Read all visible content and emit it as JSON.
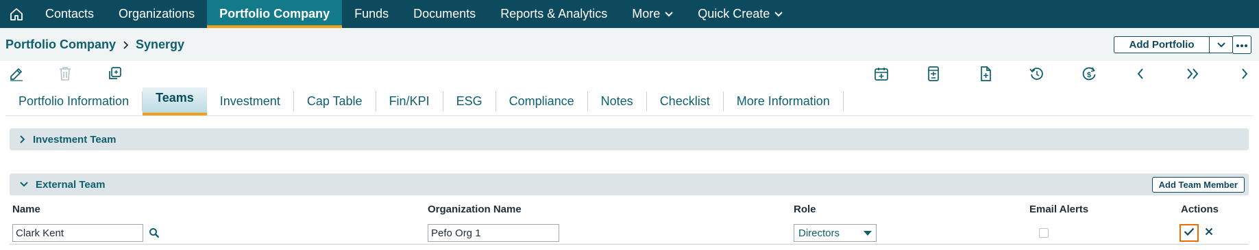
{
  "topnav": {
    "home_icon": "home-icon",
    "items": [
      {
        "label": "Contacts"
      },
      {
        "label": "Organizations"
      },
      {
        "label": "Portfolio Company",
        "active": true
      },
      {
        "label": "Funds"
      },
      {
        "label": "Documents"
      },
      {
        "label": "Reports & Analytics"
      },
      {
        "label": "More",
        "dropdown": true
      },
      {
        "label": "Quick Create",
        "dropdown": true
      }
    ],
    "colors": {
      "background": "#0e4a5e",
      "active": "#137a8a",
      "active_underline": "#f0a11c"
    }
  },
  "header": {
    "breadcrumb": [
      "Portfolio Company",
      "Synergy"
    ],
    "add_portfolio_label": "Add Portfolio"
  },
  "toolbar": {
    "left_icons": [
      "edit-icon",
      "delete-icon",
      "copy-icon"
    ],
    "right_icons": [
      "calendar-add-icon",
      "calculator-icon",
      "document-add-icon",
      "history-icon",
      "currency-cycle-icon",
      "chevron-left-icon",
      "double-chevron-right-icon",
      "chevron-right-icon"
    ]
  },
  "tabs": [
    {
      "label": "Portfolio Information"
    },
    {
      "label": "Teams",
      "active": true
    },
    {
      "label": "Investment"
    },
    {
      "label": "Cap Table"
    },
    {
      "label": "Fin/KPI"
    },
    {
      "label": "ESG"
    },
    {
      "label": "Compliance"
    },
    {
      "label": "Notes"
    },
    {
      "label": "Checklist"
    },
    {
      "label": "More Information"
    }
  ],
  "sections": {
    "investment_team": {
      "title": "Investment Team",
      "expanded": false
    },
    "external_team": {
      "title": "External Team",
      "expanded": true,
      "add_button": "Add Team Member"
    }
  },
  "table": {
    "columns": [
      "Name",
      "Organization Name",
      "Role",
      "Email Alerts",
      "Actions"
    ],
    "rows": [
      {
        "name": "Clark Kent",
        "organization": "Pefo Org 1",
        "role": "Directors",
        "email_alerts": false
      }
    ]
  },
  "colors": {
    "accent": "#0e5f6e",
    "highlight": "#f06c00"
  }
}
